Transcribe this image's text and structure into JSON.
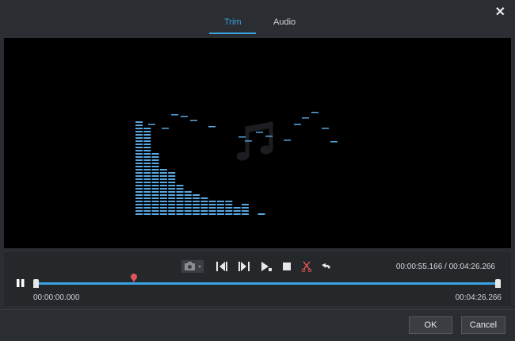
{
  "tabs": [
    {
      "label": "Trim",
      "active": true
    },
    {
      "label": "Audio",
      "active": false
    }
  ],
  "playback": {
    "current_time": "00:00:55.166",
    "separator": " / ",
    "total_time": "00:04:26.266",
    "progress": 0.215
  },
  "trim": {
    "start_time": "00:00:00.000",
    "end_time": "00:04:26.266",
    "marker_fraction": 0.215
  },
  "toolbar": {
    "icons": [
      "camera-icon",
      "set-start-icon",
      "set-end-icon",
      "play-segment-icon",
      "stop-icon",
      "cut-icon",
      "undo-icon"
    ]
  },
  "footer": {
    "ok_label": "OK",
    "cancel_label": "Cancel"
  },
  "colors": {
    "accent": "#3aa3e3",
    "marker": "#e05555",
    "bars": "#5aa7e0"
  }
}
